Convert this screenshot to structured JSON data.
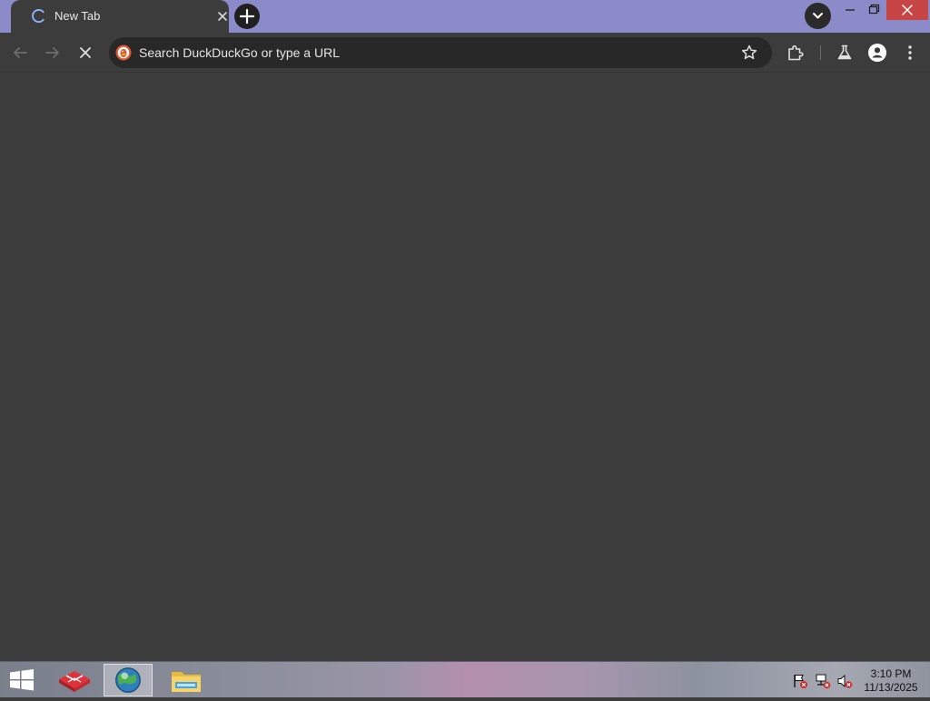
{
  "browser": {
    "tab": {
      "title": "New Tab"
    },
    "omnibox": {
      "placeholder": "Search DuckDuckGo or type a URL"
    },
    "icons": {
      "tab_loading": "spinner-icon",
      "tab_close": "close-icon",
      "new_tab": "plus-icon",
      "tab_search": "chevron-down-icon",
      "back": "arrow-left-icon",
      "forward": "arrow-right-icon",
      "stop": "close-icon",
      "search_engine": "duckduckgo-icon",
      "bookmark": "star-icon",
      "extensions": "puzzle-icon",
      "labs": "flask-icon",
      "profile": "person-icon",
      "menu": "kebab-menu-icon"
    }
  },
  "taskbar": {
    "apps": [
      {
        "name": "start",
        "icon": "windows-logo-icon"
      },
      {
        "name": "app-red",
        "icon": "red-box-icon"
      },
      {
        "name": "browser",
        "icon": "globe-icon",
        "active": true
      },
      {
        "name": "file-explorer",
        "icon": "folder-icon"
      }
    ],
    "tray": {
      "icons": [
        "flag-error-icon",
        "network-error-icon",
        "speaker-muted-icon"
      ]
    },
    "clock": {
      "time": "3:10 PM",
      "date": "11/13/2025"
    }
  },
  "colors": {
    "titlebar": "#8b8bc9",
    "surface": "#3c3c3c",
    "omnibox": "#282828",
    "close_button": "#c74545"
  }
}
